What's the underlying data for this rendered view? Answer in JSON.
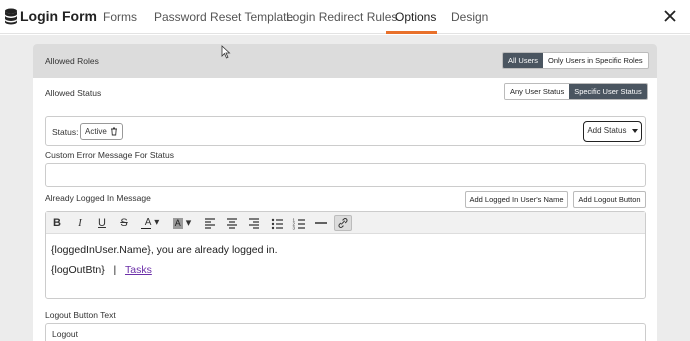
{
  "header": {
    "title": "Login Form",
    "tabs": [
      {
        "label": "Forms"
      },
      {
        "label": "Password Reset Template"
      },
      {
        "label": "Login Redirect Rules"
      },
      {
        "label": "Options"
      },
      {
        "label": "Design"
      }
    ],
    "active_tab": "Options",
    "accent_color": "#e8702a"
  },
  "allowed_roles": {
    "label": "Allowed Roles",
    "options": [
      "All Users",
      "Only Users in Specific Roles"
    ],
    "selected": "All Users"
  },
  "allowed_status": {
    "label": "Allowed Status",
    "options": [
      "Any User Status",
      "Specific User Status"
    ],
    "selected": "Specific User Status",
    "status_label": "Status:",
    "chip": "Active",
    "add_button": "Add Status"
  },
  "custom_error": {
    "label": "Custom Error Message For Status",
    "value": ""
  },
  "already_logged_in": {
    "label": "Already Logged In Message",
    "add_name_button": "Add Logged In User's Name",
    "add_logout_button": "Add Logout Button",
    "line1": "{loggedInUser.Name}, you are already logged in.",
    "line2_prefix": "{logOutBtn}",
    "line2_sep": "|",
    "line2_link": "Tasks"
  },
  "logout_button_text": {
    "label": "Logout Button Text",
    "value": "Logout"
  }
}
